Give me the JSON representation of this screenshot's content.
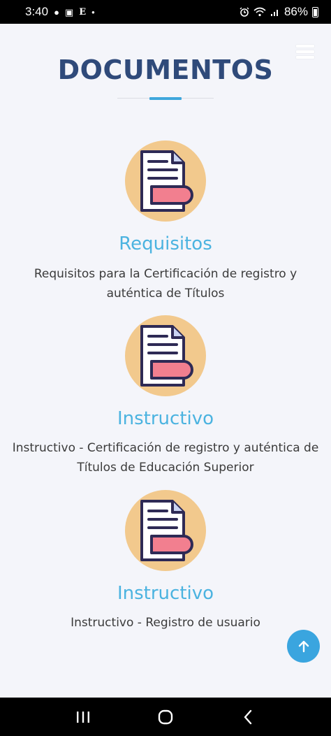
{
  "status_bar": {
    "time": "3:40",
    "battery": "86%"
  },
  "header": {
    "title": "DOCUMENTOS"
  },
  "cards": [
    {
      "title": "Requisitos",
      "desc_line1": "Requisitos para la Certificación de registro y",
      "desc_line2": "auténtica de Títulos"
    },
    {
      "title": "Instructivo",
      "desc_line1": "Instructivo - Certificación de registro y auténtica de",
      "desc_line2": "Títulos de Educación Superior"
    },
    {
      "title": "Instructivo",
      "desc_line1": "Instructivo - Registro de usuario",
      "desc_line2": ""
    }
  ],
  "colors": {
    "title": "#2f4a7a",
    "accent": "#3fa7dc",
    "card_title": "#4bb3e0",
    "icon_circle": "#f2c98d",
    "icon_tag": "#f27f8f"
  }
}
